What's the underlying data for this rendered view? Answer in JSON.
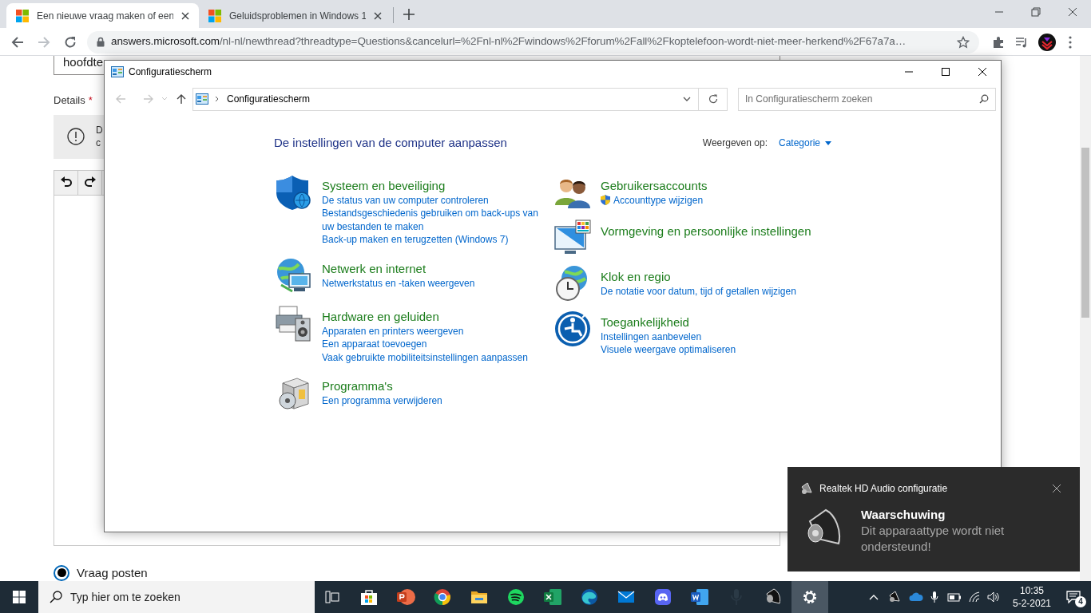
{
  "browser": {
    "tabs": [
      {
        "title": "Een nieuwe vraag maken of een",
        "selected": true
      },
      {
        "title": "Geluidsproblemen in Windows 1",
        "selected": false
      }
    ],
    "address": {
      "host": "answers.microsoft.com",
      "path": "/nl-nl/newthread?threadtype=Questions&cancelurl=%2Fnl-nl%2Fwindows%2Fforum%2Fall%2Fkoptelefoon-wordt-niet-meer-herkend%2F67a7a…"
    }
  },
  "background_page": {
    "subject_value": "hoofdte",
    "details_label": "Details",
    "required_mark": "*",
    "notice_lines": [
      "D",
      "c"
    ],
    "radio": {
      "label": "Vraag posten",
      "selected": true
    }
  },
  "control_panel": {
    "title": "Configuratiescherm",
    "breadcrumb": "Configuratiescherm",
    "search": {
      "placeholder": "In Configuratiescherm zoeken"
    },
    "heading": "De instellingen van de computer aanpassen",
    "view_label": "Weergeven op:",
    "view_value": "Categorie",
    "columns": [
      [
        {
          "title": "Systeem en beveiliging",
          "links": [
            {
              "text": "De status van uw computer controleren",
              "shield": false
            },
            {
              "text": "Bestandsgeschiedenis gebruiken om back-ups van uw bestanden te maken",
              "shield": false
            },
            {
              "text": "Back-up maken en terugzetten (Windows 7)",
              "shield": false
            }
          ]
        },
        {
          "title": "Netwerk en internet",
          "links": [
            {
              "text": "Netwerkstatus en -taken weergeven",
              "shield": false
            }
          ]
        },
        {
          "title": "Hardware en geluiden",
          "links": [
            {
              "text": "Apparaten en printers weergeven",
              "shield": false
            },
            {
              "text": "Een apparaat toevoegen",
              "shield": false
            },
            {
              "text": "Vaak gebruikte mobiliteitsinstellingen aanpassen",
              "shield": false
            }
          ]
        },
        {
          "title": "Programma's",
          "links": [
            {
              "text": "Een programma verwijderen",
              "shield": false
            }
          ]
        }
      ],
      [
        {
          "title": "Gebruikersaccounts",
          "links": [
            {
              "text": "Accounttype wijzigen",
              "shield": true
            }
          ]
        },
        {
          "title": "Vormgeving en persoonlijke instellingen"
        },
        {
          "title": "Klok en regio",
          "links": [
            {
              "text": "De notatie voor datum, tijd of getallen wijzigen",
              "shield": false
            }
          ]
        },
        {
          "title": "Toegankelijkheid",
          "links": [
            {
              "text": "Instellingen aanbevelen",
              "shield": false
            },
            {
              "text": "Visuele weergave optimaliseren",
              "shield": false
            }
          ]
        }
      ]
    ]
  },
  "notification": {
    "app": "Realtek HD Audio configuratie",
    "title": "Waarschuwing",
    "message": "Dit apparaattype wordt niet ondersteund!"
  },
  "taskbar": {
    "search": {
      "placeholder": "Typ hier om te zoeken"
    },
    "apps": [
      {
        "selected": false
      },
      {
        "selected": false
      },
      {
        "selected": false
      },
      {
        "selected": false
      },
      {
        "selected": false
      },
      {
        "selected": false
      },
      {
        "selected": false
      },
      {
        "selected": false
      },
      {
        "selected": false
      },
      {
        "selected": false
      },
      {
        "selected": false
      },
      {
        "selected": false
      },
      {
        "selected": false
      },
      {
        "selected": true
      }
    ],
    "time": "10:35",
    "date": "5-2-2021",
    "notification_count": "4"
  }
}
